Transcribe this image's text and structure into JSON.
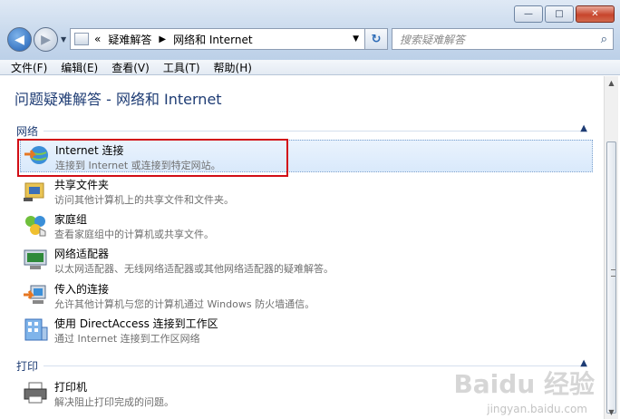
{
  "window": {
    "minimize_label": "—",
    "maximize_label": "□",
    "close_label": "✕"
  },
  "address": {
    "chevrons": "«",
    "crumbs": [
      "疑难解答",
      "网络和 Internet"
    ],
    "separator": "▶"
  },
  "search": {
    "placeholder": "搜索疑难解答"
  },
  "menu": [
    "文件(F)",
    "编辑(E)",
    "查看(V)",
    "工具(T)",
    "帮助(H)"
  ],
  "page": {
    "title": "问题疑难解答 - 网络和 Internet"
  },
  "sections": [
    {
      "label": "网络",
      "items": [
        {
          "title": "Internet 连接",
          "desc": "连接到 Internet 或连接到特定网站。",
          "icon": "globe-network-icon",
          "selected": true
        },
        {
          "title": "共享文件夹",
          "desc": "访问其他计算机上的共享文件和文件夹。",
          "icon": "shared-folder-icon"
        },
        {
          "title": "家庭组",
          "desc": "查看家庭组中的计算机或共享文件。",
          "icon": "homegroup-icon"
        },
        {
          "title": "网络适配器",
          "desc": "以太网适配器、无线网络适配器或其他网络适配器的疑难解答。",
          "icon": "network-adapter-icon"
        },
        {
          "title": "传入的连接",
          "desc": "允许其他计算机与您的计算机通过 Windows 防火墙通信。",
          "icon": "incoming-connection-icon"
        },
        {
          "title": "使用 DirectAccess 连接到工作区",
          "desc": "通过 Internet 连接到工作区网络",
          "icon": "workplace-building-icon"
        }
      ]
    },
    {
      "label": "打印",
      "items": [
        {
          "title": "打印机",
          "desc": "解决阻止打印完成的问题。",
          "icon": "printer-icon"
        }
      ]
    }
  ],
  "watermark": {
    "logo": "Baidu 经验",
    "url": "jingyan.baidu.com"
  }
}
